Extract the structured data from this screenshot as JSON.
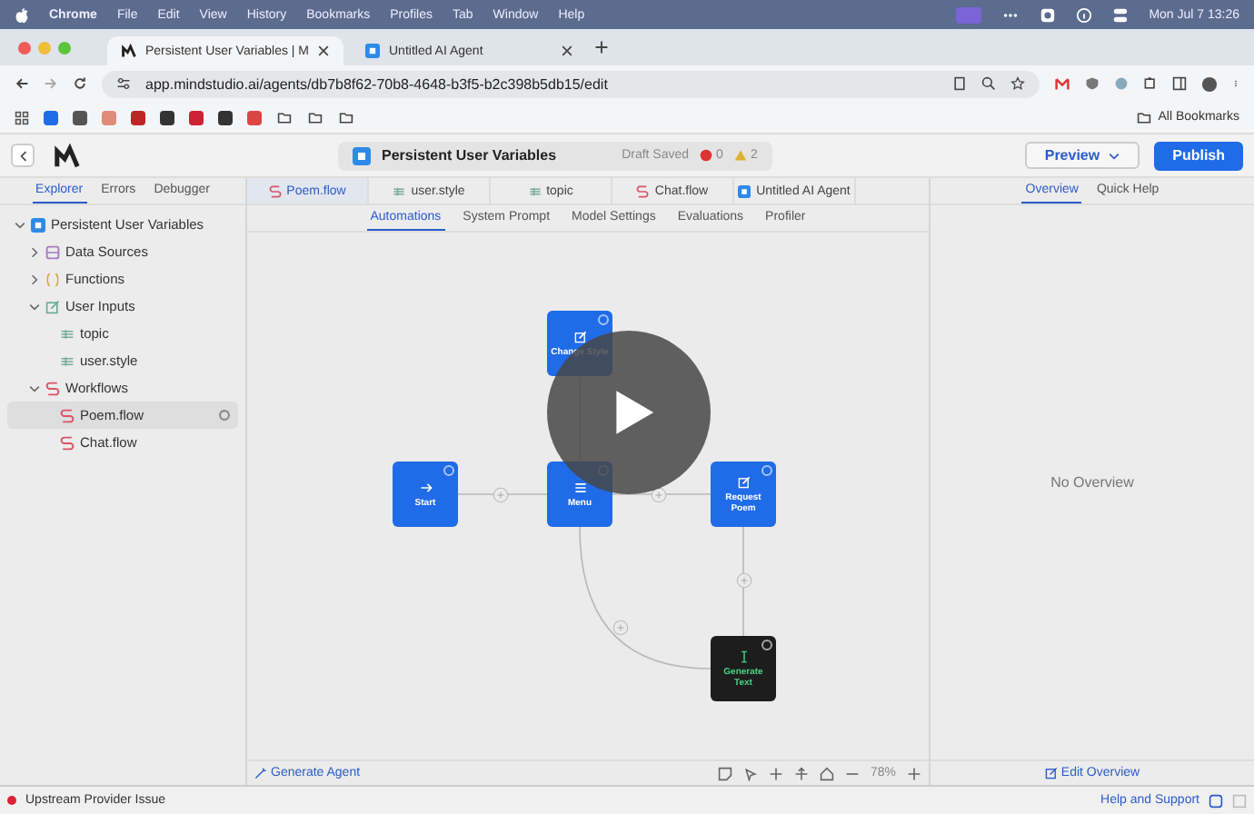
{
  "menubar": {
    "app": "Chrome",
    "menus": [
      "File",
      "Edit",
      "View",
      "History",
      "Bookmarks",
      "Profiles",
      "Tab",
      "Window",
      "Help"
    ],
    "clock": "Mon Jul 7  13:26"
  },
  "browser": {
    "tabs": [
      {
        "title": "Persistent User Variables | M",
        "selected": true,
        "kind": "mind"
      },
      {
        "title": "Untitled AI Agent",
        "selected": false,
        "kind": "agent"
      }
    ],
    "url": "app.mindstudio.ai/agents/db7b8f62-70b8-4648-b3f5-b2c398b5db15/edit",
    "all_bookmarks": "All Bookmarks"
  },
  "header": {
    "title": "Persistent User Variables",
    "status": "Draft Saved",
    "errors": "0",
    "warnings": "2",
    "preview": "Preview",
    "publish": "Publish"
  },
  "sidebar": {
    "tabs": [
      {
        "label": "Explorer",
        "selected": true
      },
      {
        "label": "Errors",
        "selected": false
      },
      {
        "label": "Debugger",
        "selected": false
      }
    ],
    "tree": [
      {
        "label": "Persistent User Variables",
        "kind": "project",
        "expanded": true,
        "selected": false,
        "children": [
          {
            "label": "Data Sources",
            "kind": "data",
            "expanded": false,
            "selected": false
          },
          {
            "label": "Functions",
            "kind": "functions",
            "expanded": false,
            "selected": false
          },
          {
            "label": "User Inputs",
            "kind": "inputs",
            "expanded": true,
            "selected": false,
            "children": [
              {
                "label": "topic",
                "kind": "variable",
                "selected": false
              },
              {
                "label": "user.style",
                "kind": "variable",
                "selected": false
              }
            ]
          },
          {
            "label": "Workflows",
            "kind": "workflows",
            "expanded": true,
            "selected": false,
            "children": [
              {
                "label": "Poem.flow",
                "kind": "flow",
                "selected": true
              },
              {
                "label": "Chat.flow",
                "kind": "flow",
                "selected": false
              }
            ]
          }
        ]
      }
    ]
  },
  "file_tabs": [
    {
      "label": "Poem.flow",
      "kind": "flow",
      "selected": true
    },
    {
      "label": "user.style",
      "kind": "variable",
      "selected": false
    },
    {
      "label": "topic",
      "kind": "variable",
      "selected": false
    },
    {
      "label": "Chat.flow",
      "kind": "flow",
      "selected": false
    },
    {
      "label": "Untitled AI Agent",
      "kind": "agent",
      "selected": false
    }
  ],
  "sub_tabs": [
    {
      "label": "Automations",
      "selected": true
    },
    {
      "label": "System Prompt",
      "selected": false
    },
    {
      "label": "Model Settings",
      "selected": false
    },
    {
      "label": "Evaluations",
      "selected": false
    },
    {
      "label": "Profiler",
      "selected": false
    }
  ],
  "canvas": {
    "nodes": [
      {
        "label": "Change Style",
        "kind": "edit"
      },
      {
        "label": "Start",
        "kind": "start"
      },
      {
        "label": "Menu",
        "kind": "menu"
      },
      {
        "label": "Request Poem",
        "kind": "edit"
      },
      {
        "label": "Generate Text",
        "kind": "generate"
      }
    ],
    "generate_agent": "Generate Agent",
    "zoom": "78%"
  },
  "right_panel": {
    "tabs": [
      {
        "label": "Overview",
        "selected": true
      },
      {
        "label": "Quick Help",
        "selected": false
      }
    ],
    "empty": "No Overview",
    "edit": "Edit Overview"
  },
  "status_bar": {
    "issue": "Upstream Provider Issue",
    "help": "Help and Support"
  }
}
